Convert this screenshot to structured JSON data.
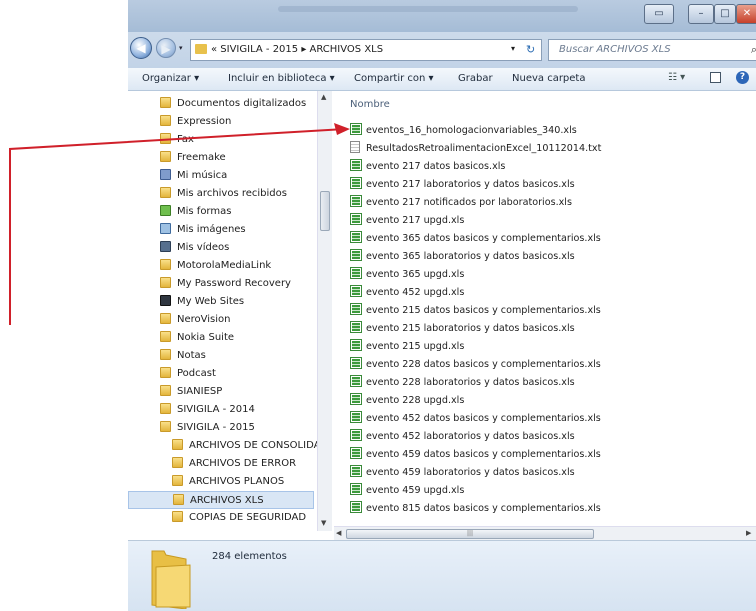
{
  "address": {
    "path": "« SIVIGILA - 2015 ▸ ARCHIVOS XLS",
    "search_placeholder": "Buscar ARCHIVOS XLS"
  },
  "toolbar": {
    "organize": "Organizar ▾",
    "library": "Incluir en biblioteca ▾",
    "share": "Compartir con ▾",
    "burn": "Grabar",
    "new_folder": "Nueva carpeta"
  },
  "nav_items": [
    {
      "label": "Documentos digitalizados",
      "icon": "folder-icon"
    },
    {
      "label": "Expression",
      "icon": "folder-icon"
    },
    {
      "label": "Fax",
      "icon": "folder-icon"
    },
    {
      "label": "Freemake",
      "icon": "folder-icon"
    },
    {
      "label": "Mi música",
      "icon": "music-folder-icon"
    },
    {
      "label": "Mis archivos recibidos",
      "icon": "folder-icon"
    },
    {
      "label": "Mis formas",
      "icon": "forms-folder-icon"
    },
    {
      "label": "Mis imágenes",
      "icon": "pictures-folder-icon"
    },
    {
      "label": "Mis vídeos",
      "icon": "videos-folder-icon"
    },
    {
      "label": "MotorolaMediaLink",
      "icon": "folder-icon"
    },
    {
      "label": "My Password Recovery",
      "icon": "folder-icon"
    },
    {
      "label": "My Web Sites",
      "icon": "websites-folder-icon"
    },
    {
      "label": "NeroVision",
      "icon": "folder-icon"
    },
    {
      "label": "Nokia Suite",
      "icon": "folder-icon"
    },
    {
      "label": "Notas",
      "icon": "folder-icon"
    },
    {
      "label": "Podcast",
      "icon": "folder-icon"
    },
    {
      "label": "SIANIESP",
      "icon": "folder-icon"
    },
    {
      "label": "SIVIGILA - 2014",
      "icon": "folder-icon"
    },
    {
      "label": "SIVIGILA - 2015",
      "icon": "folder-icon"
    },
    {
      "label": "ARCHIVOS DE CONSOLIDA",
      "icon": "folder-icon"
    },
    {
      "label": "ARCHIVOS DE ERROR",
      "icon": "folder-icon"
    },
    {
      "label": "ARCHIVOS PLANOS",
      "icon": "folder-icon"
    },
    {
      "label": "ARCHIVOS XLS",
      "icon": "folder-icon",
      "selected": true
    },
    {
      "label": "COPIAS DE SEGURIDAD",
      "icon": "folder-icon"
    }
  ],
  "column_header": "Nombre",
  "files": [
    {
      "name": "eventos_16_homologacionvariables_340.xls",
      "type": "xls"
    },
    {
      "name": "ResultadosRetroalimentacionExcel_10112014.txt",
      "type": "txt"
    },
    {
      "name": "evento 217 datos basicos.xls",
      "type": "xls"
    },
    {
      "name": "evento 217 laboratorios y datos basicos.xls",
      "type": "xls"
    },
    {
      "name": "evento 217 notificados por laboratorios.xls",
      "type": "xls"
    },
    {
      "name": "evento 217 upgd.xls",
      "type": "xls"
    },
    {
      "name": "evento 365 datos basicos y complementarios.xls",
      "type": "xls"
    },
    {
      "name": "evento 365 laboratorios y datos basicos.xls",
      "type": "xls"
    },
    {
      "name": "evento 365 upgd.xls",
      "type": "xls"
    },
    {
      "name": "evento 452 upgd.xls",
      "type": "xls"
    },
    {
      "name": "evento 215 datos basicos y complementarios.xls",
      "type": "xls"
    },
    {
      "name": "evento 215 laboratorios y datos basicos.xls",
      "type": "xls"
    },
    {
      "name": "evento 215 upgd.xls",
      "type": "xls"
    },
    {
      "name": "evento 228 datos basicos y complementarios.xls",
      "type": "xls"
    },
    {
      "name": "evento 228 laboratorios y datos basicos.xls",
      "type": "xls"
    },
    {
      "name": "evento 228 upgd.xls",
      "type": "xls"
    },
    {
      "name": "evento 452 datos basicos y complementarios.xls",
      "type": "xls"
    },
    {
      "name": "evento 452 laboratorios y datos basicos.xls",
      "type": "xls"
    },
    {
      "name": "evento 459 datos basicos y complementarios.xls",
      "type": "xls"
    },
    {
      "name": "evento 459 laboratorios y datos basicos.xls",
      "type": "xls"
    },
    {
      "name": "evento 459 upgd.xls",
      "type": "xls"
    },
    {
      "name": "evento 815 datos basicos y complementarios.xls",
      "type": "xls"
    }
  ],
  "details": {
    "count": "284 elementos"
  },
  "colors": {
    "annotation_arrow": "#d0202a",
    "folder": "#e3b53c",
    "selection": "#d9e6f5"
  }
}
